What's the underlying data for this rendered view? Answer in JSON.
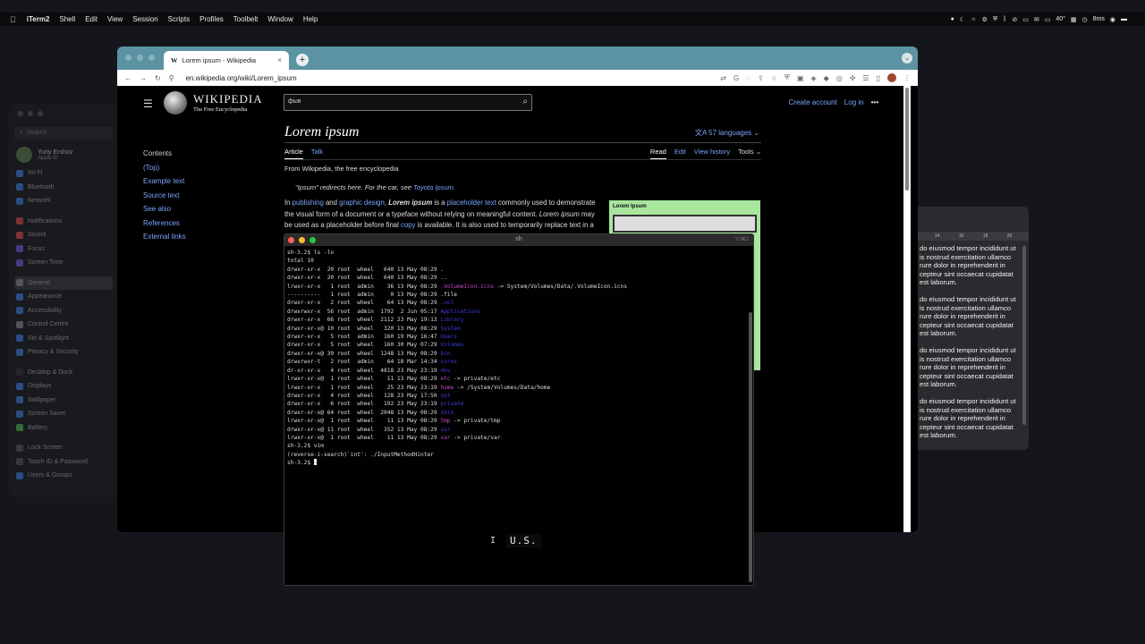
{
  "menubar": {
    "app": "iTerm2",
    "items": [
      "Shell",
      "Edit",
      "View",
      "Session",
      "Scripts",
      "Profiles",
      "Toolbelt",
      "Window",
      "Help"
    ],
    "status_net": "40°",
    "status_ms": "8ms"
  },
  "settings": {
    "search_placeholder": "Search",
    "user_name": "Yuriy Ershov",
    "user_sub": "Apple ID",
    "groups": [
      [
        "Wi-Fi",
        "Bluetooth",
        "Network"
      ],
      [
        "Notifications",
        "Sound",
        "Focus",
        "Screen Time"
      ],
      [
        "General",
        "Appearance",
        "Accessibility",
        "Control Centre",
        "Siri & Spotlight",
        "Privacy & Security"
      ],
      [
        "Desktop & Dock",
        "Displays",
        "Wallpaper",
        "Screen Saver",
        "Battery"
      ],
      [
        "Lock Screen",
        "Touch ID & Password",
        "Users & Groups"
      ]
    ],
    "selected": "General"
  },
  "docwin": {
    "ruler": [
      "14",
      "16",
      "18",
      "20"
    ],
    "paragraphs": [
      "do eiusmod tempor incididunt ut is nostrud exercitation ullamco rure dolor in reprehenderit in cepteur sint occaecat cupidatat est laborum.",
      "do eiusmod tempor incididunt ut is nostrud exercitation ullamco rure dolor in reprehenderit in cepteur sint occaecat cupidatat est laborum.",
      "do eiusmod tempor incididunt ut is nostrud exercitation ullamco rure dolor in reprehenderit in cepteur sint occaecat cupidatat est laborum.",
      "do eiusmod tempor incididunt ut is nostrud exercitation ullamco rure dolor in reprehenderit in cepteur sint occaecat cupidatat est laborum."
    ]
  },
  "browser": {
    "tab_title": "Lorem ipsum - Wikipedia",
    "new_tab": "+",
    "url": "en.wikipedia.org/wiki/Lorem_ipsum"
  },
  "wiki": {
    "brand1": "WIKIPEDIA",
    "brand2": "The Free Encyclopedia",
    "search_value": "фыв",
    "create_account": "Create account",
    "login": "Log in",
    "toc_heading": "Contents",
    "toc": [
      "(Top)",
      "Example text",
      "Source text",
      "See also",
      "References",
      "External links"
    ],
    "title": "Lorem ipsum",
    "languages": "57 languages",
    "tab_article": "Article",
    "tab_talk": "Talk",
    "tab_read": "Read",
    "tab_edit": "Edit",
    "tab_history": "View history",
    "tab_tools": "Tools",
    "from": "From Wikipedia, the free encyclopedia",
    "hatnote_pre": "\"Ipsum\" redirects here. For the car, see ",
    "hatnote_link": "Toyota Ipsum",
    "hatnote_post": ".",
    "para_in": "In ",
    "para_publishing": "publishing",
    "para_and": " and ",
    "para_graphic": "graphic design",
    "para_comma": ", ",
    "para_lorem": "Lorem ipsum",
    "para_isa": " is a ",
    "para_placeholder": "placeholder text",
    "para_rest1": " commonly used to demonstrate the visual form of a document or a typeface without relying on meaningful content. ",
    "para_lorem2": "Lorem ipsum",
    "para_rest2": " may be used as a placeholder before final ",
    "para_copy": "copy",
    "para_rest3": " is available. It is also used to temporarily replace text in a",
    "infobox_title": "Lorem Ipsum"
  },
  "terminal": {
    "title": "sh",
    "shortcut": "⌥⌘2",
    "lines": [
      {
        "t": "sh-3.2$ ls -lo"
      },
      {
        "t": "total 10"
      },
      {
        "t": "drwxr-xr-x  20 root  wheel   640 13 May 08:29 ",
        "h": ".",
        "c": ""
      },
      {
        "t": "drwxr-xr-x  20 root  wheel   640 13 May 08:29 ",
        "h": "..",
        "c": ""
      },
      {
        "t": "lrwxr-xr-x   1 root  admin    36 13 May 08:29 ",
        "h": ".VolumeIcon.icns",
        "c": "mag",
        "tail": " -> System/Volumes/Data/.VolumeIcon.icns"
      },
      {
        "t": "----------   1 root  admin     0 13 May 08:29 .file"
      },
      {
        "t": "drwxr-xr-x   2 root  wheel    64 13 May 08:29 ",
        "h": ".vol",
        "c": "blu"
      },
      {
        "t": "drwxrwxr-x  56 root  admin  1792  2 Jun 05:17 ",
        "h": "Applications",
        "c": "blu"
      },
      {
        "t": "drwxr-xr-x  66 root  wheel  2112 23 May 19:13 ",
        "h": "Library",
        "c": "blu"
      },
      {
        "t": "drwxr-xr-x@ 10 root  wheel   320 13 May 08:29 ",
        "h": "System",
        "c": "blu"
      },
      {
        "t": "drwxr-xr-x   5 root  admin   160 19 May 16:47 ",
        "h": "Users",
        "c": "blu"
      },
      {
        "t": "drwxr-xr-x   5 root  wheel   160 30 May 07:29 ",
        "h": "Volumes",
        "c": "blu"
      },
      {
        "t": "drwxr-xr-x@ 39 root  wheel  1248 13 May 08:29 ",
        "h": "bin",
        "c": "blu"
      },
      {
        "t": "drwxrwxr-t   2 root  admin    64 18 Mar 14:34 ",
        "h": "cores",
        "c": "blu"
      },
      {
        "t": "dr-xr-xr-x   4 root  wheel  4818 23 May 23:19 ",
        "h": "dev",
        "c": "blu"
      },
      {
        "t": "lrwxr-xr-x@  1 root  wheel    11 13 May 08:29 ",
        "h": "etc",
        "c": "mag",
        "tail": " -> private/etc"
      },
      {
        "t": "lrwxr-xr-x   1 root  wheel    25 23 May 23:19 ",
        "h": "home",
        "c": "mag",
        "tail": " -> /System/Volumes/Data/home"
      },
      {
        "t": "drwxr-xr-x   4 root  wheel   128 23 May 17:50 ",
        "h": "opt",
        "c": "blu"
      },
      {
        "t": "drwxr-xr-x   6 root  wheel   192 23 May 23:19 ",
        "h": "private",
        "c": "blu"
      },
      {
        "t": "drwxr-xr-x@ 64 root  wheel  2048 13 May 08:29 ",
        "h": "sbin",
        "c": "blu"
      },
      {
        "t": "lrwxr-xr-x@  1 root  wheel    11 13 May 08:29 ",
        "h": "tmp",
        "c": "mag",
        "tail": " -> private/tmp"
      },
      {
        "t": "drwxr-xr-x@ 11 root  wheel   352 13 May 08:29 ",
        "h": "usr",
        "c": "blu"
      },
      {
        "t": "lrwxr-xr-x@  1 root  wheel    11 13 May 08:29 ",
        "h": "var",
        "c": "mag",
        "tail": " -> private/var"
      },
      {
        "t": "sh-3.2$ vim"
      },
      {
        "t": "(reverse-i-search)`int': ./InputMethodHinter"
      },
      {
        "t": "sh-3.2$ ",
        "cursor": true
      }
    ],
    "ime_lang": "U.S."
  }
}
